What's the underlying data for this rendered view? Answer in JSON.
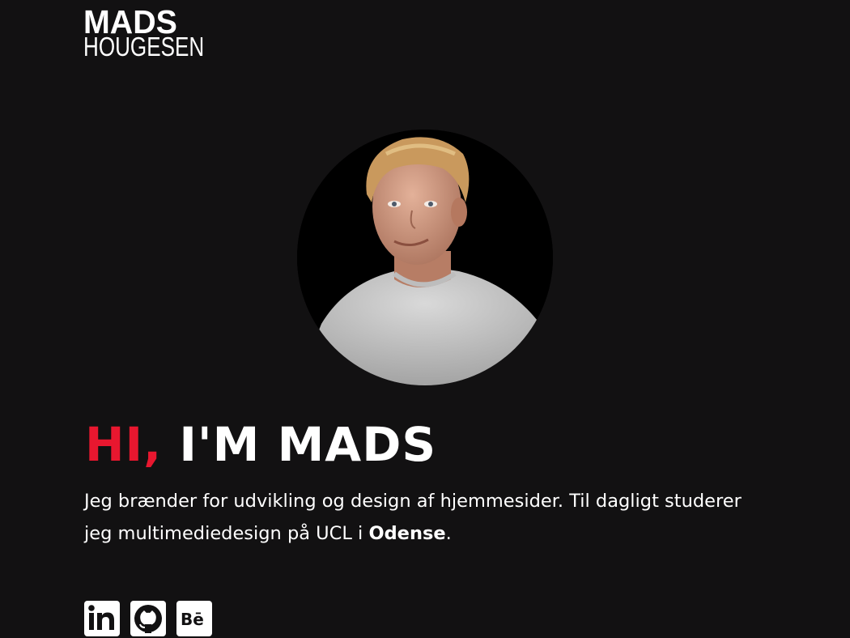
{
  "header": {
    "logo_line1": "MADS",
    "logo_line2": "HOUGESEN"
  },
  "hero": {
    "greeting_accent": "HI,",
    "greeting_rest": " I'M MADS",
    "intro_text": "Jeg brænder for udvikling og design af hjemmesider. Til dagligt studerer jeg multimediedesign på UCL i ",
    "intro_city": "Odense",
    "intro_end": "."
  },
  "social": {
    "items": [
      {
        "icon": "linkedin-icon",
        "label": "in"
      },
      {
        "icon": "github-icon"
      },
      {
        "icon": "behance-icon",
        "label": "Bē"
      }
    ]
  },
  "colors": {
    "background": "#121112",
    "accent": "#e8172f",
    "text": "#ffffff"
  }
}
